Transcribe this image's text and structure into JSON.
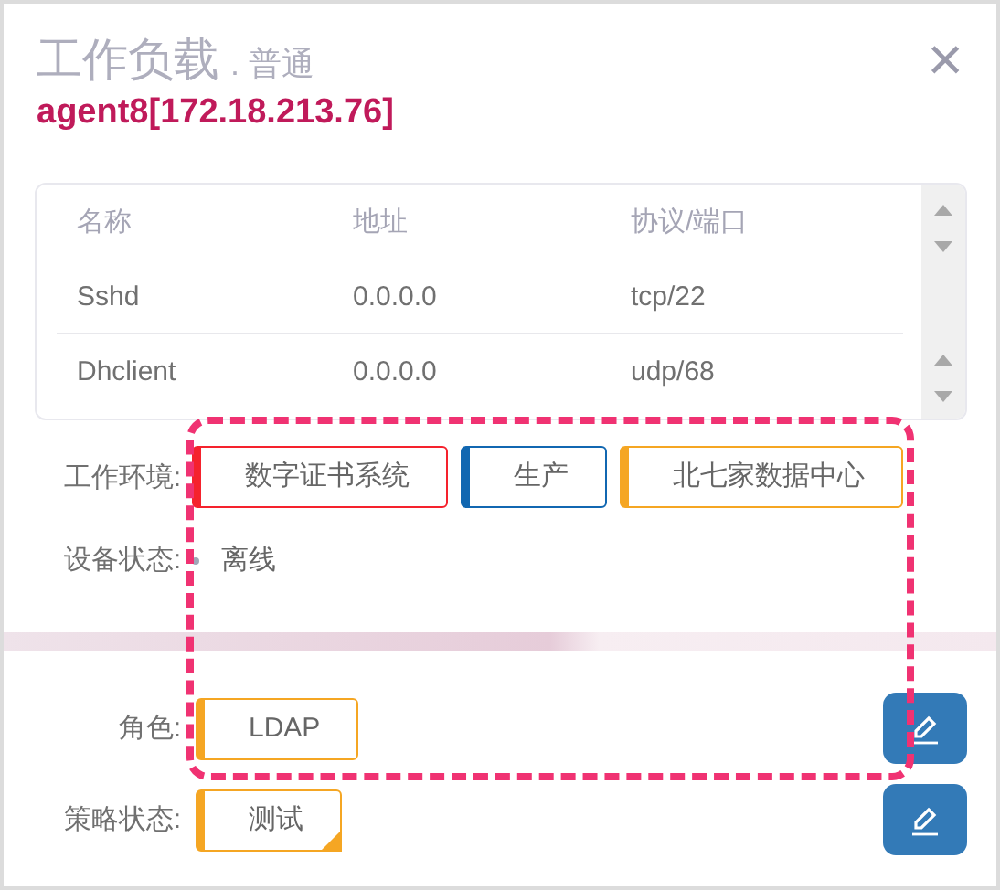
{
  "dialog": {
    "title": "工作负载",
    "subtitle": ". 普通",
    "agent": "agent8[172.18.213.76]",
    "close": "×"
  },
  "table": {
    "columns": [
      "名称",
      "地址",
      "协议/端口"
    ],
    "rows": [
      [
        "Sshd",
        "0.0.0.0",
        "tcp/22"
      ],
      [
        "Dhclient",
        "0.0.0.0",
        "udp/68"
      ]
    ]
  },
  "fields": [
    {
      "label": "工作环境:",
      "kind": "tags",
      "tags": [
        {
          "text": "数字证书系统",
          "color": "#f5222d"
        },
        {
          "text": "生产",
          "color": "#1167b1"
        },
        {
          "text": "北七家数据中心",
          "color": "#f5a623"
        }
      ]
    },
    {
      "label": "设备状态:",
      "kind": "status",
      "value": "离线",
      "online": false
    }
  ],
  "assignments": [
    {
      "label": "角色:",
      "tag": {
        "text": "LDAP",
        "color": "#f5a623"
      },
      "marked": false
    },
    {
      "label": "策略状态:",
      "tag": {
        "text": "测试",
        "color": "#f5a623"
      },
      "marked": true
    }
  ],
  "annotation": {
    "kind": "dashed-frame"
  }
}
